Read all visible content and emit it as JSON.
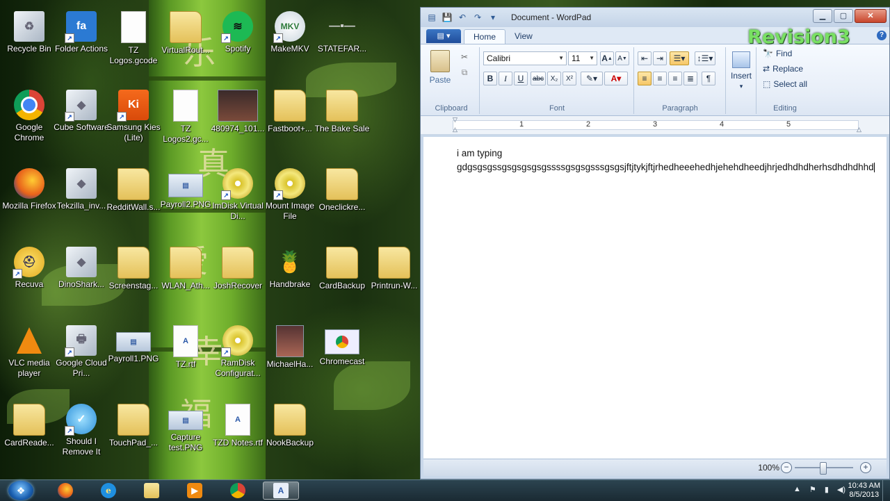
{
  "desktop": {
    "icons": [
      {
        "label": "Recycle Bin"
      },
      {
        "label": "Folder Actions"
      },
      {
        "label": "TZ Logos.gcode"
      },
      {
        "label": "VirtualRout..."
      },
      {
        "label": "Spotify"
      },
      {
        "label": "MakeMKV"
      },
      {
        "label": "STATEFAR..."
      },
      {
        "label": "Google Chrome"
      },
      {
        "label": "Cube Software"
      },
      {
        "label": "Samsung Kies (Lite)"
      },
      {
        "label": "TZ Logos2.gc..."
      },
      {
        "label": "480974_101..."
      },
      {
        "label": "Fastboot+..."
      },
      {
        "label": "The Bake Sale"
      },
      {
        "label": "Mozilla Firefox"
      },
      {
        "label": "Tekzilla_inv..."
      },
      {
        "label": "RedditWall.s..."
      },
      {
        "label": "Payroll2.PNG"
      },
      {
        "label": "ImDisk Virtual Di..."
      },
      {
        "label": "Mount Image File"
      },
      {
        "label": "Oneclickre..."
      },
      {
        "label": "Recuva"
      },
      {
        "label": "DinoShark..."
      },
      {
        "label": "Screenstag..."
      },
      {
        "label": "WLAN_Ath..."
      },
      {
        "label": "JoshRecover"
      },
      {
        "label": "Handbrake"
      },
      {
        "label": "CardBackup"
      },
      {
        "label": "Printrun-W..."
      },
      {
        "label": "VLC media player"
      },
      {
        "label": "Google Cloud Pri..."
      },
      {
        "label": "Payroll1.PNG"
      },
      {
        "label": "TZ.rtf"
      },
      {
        "label": "RamDisk Configurat..."
      },
      {
        "label": "MichaelHa..."
      },
      {
        "label": "Chromecast"
      },
      {
        "label": "CardReade..."
      },
      {
        "label": "Should I Remove It"
      },
      {
        "label": "TouchPad_..."
      },
      {
        "label": "Capture test.PNG"
      },
      {
        "label": "TZD Notes.rtf"
      },
      {
        "label": "NookBackup"
      }
    ]
  },
  "window": {
    "title": "Document - WordPad",
    "tabs": {
      "home": "Home",
      "view": "View"
    },
    "ribbon": {
      "clipboard": {
        "label": "Clipboard",
        "paste": "Paste"
      },
      "font": {
        "label": "Font",
        "family": "Calibri",
        "size": "11"
      },
      "paragraph": {
        "label": "Paragraph"
      },
      "insert": {
        "label": "Insert"
      },
      "editing": {
        "label": "Editing",
        "find": "Find",
        "replace": "Replace",
        "select_all": "Select all"
      }
    },
    "ruler_numbers": [
      "1",
      "2",
      "3",
      "4",
      "5"
    ],
    "document": {
      "line1": "i am typing",
      "line2": "gdgsgsgssgsgsgsgsgssssgsgsgsssgsgsjftjtykjftjrhedheeehedhjehehdheedjhrjedhdhdherhsdhdhdhhd"
    },
    "zoom": "100%"
  },
  "watermark": "Revision3",
  "taskbar": {
    "time": "10:43 AM",
    "date": "8/5/2013"
  }
}
